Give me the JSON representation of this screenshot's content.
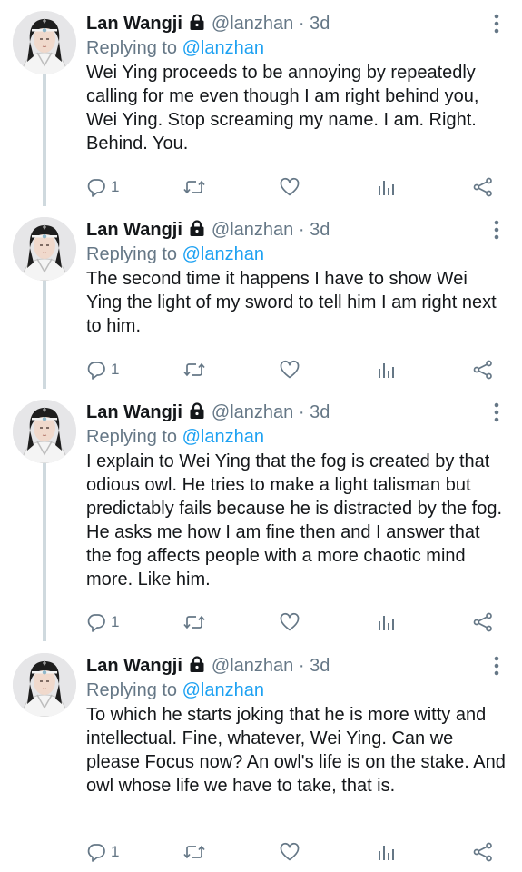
{
  "colors": {
    "text": "#14171a",
    "secondary": "#657786",
    "link": "#1da1f2",
    "thread_line": "#cfd9de"
  },
  "tweets": [
    {
      "name": "Lan Wangji",
      "handle": "@lanzhan",
      "dot": "·",
      "time": "3d",
      "reply_prefix": "Replying to",
      "reply_handle": "@lanzhan",
      "text": "Wei Ying proceeds to be annoying by repeatedly calling for me even though I am right behind you, Wei Ying. Stop screaming my name. I am. Right. Behind. You.",
      "reply_count": "1",
      "icons": [
        "lock-icon",
        "more-icon",
        "reply-icon",
        "retweet-icon",
        "like-icon",
        "analytics-icon",
        "share-icon"
      ]
    },
    {
      "name": "Lan Wangji",
      "handle": "@lanzhan",
      "dot": "·",
      "time": "3d",
      "reply_prefix": "Replying to",
      "reply_handle": "@lanzhan",
      "text": "The second time it happens I have to show Wei Ying the light of my sword to tell him I am right next to him.",
      "reply_count": "1"
    },
    {
      "name": "Lan Wangji",
      "handle": "@lanzhan",
      "dot": "·",
      "time": "3d",
      "reply_prefix": "Replying to",
      "reply_handle": "@lanzhan",
      "text": "I explain to Wei Ying that the fog is created by that odious owl. He tries to make a light talisman but predictably fails because he is distracted by the fog. He asks me how I am fine then and I answer that the fog affects people with a more chaotic mind more. Like him.",
      "reply_count": "1"
    },
    {
      "name": "Lan Wangji",
      "handle": "@lanzhan",
      "dot": "·",
      "time": "3d",
      "reply_prefix": "Replying to",
      "reply_handle": "@lanzhan",
      "text": "To which he starts joking that he is more witty and intellectual. Fine, whatever, Wei Ying. Can we please Focus now? An owl's life is on the stake. And owl whose life we have to take, that is.",
      "reply_count": "1"
    }
  ]
}
